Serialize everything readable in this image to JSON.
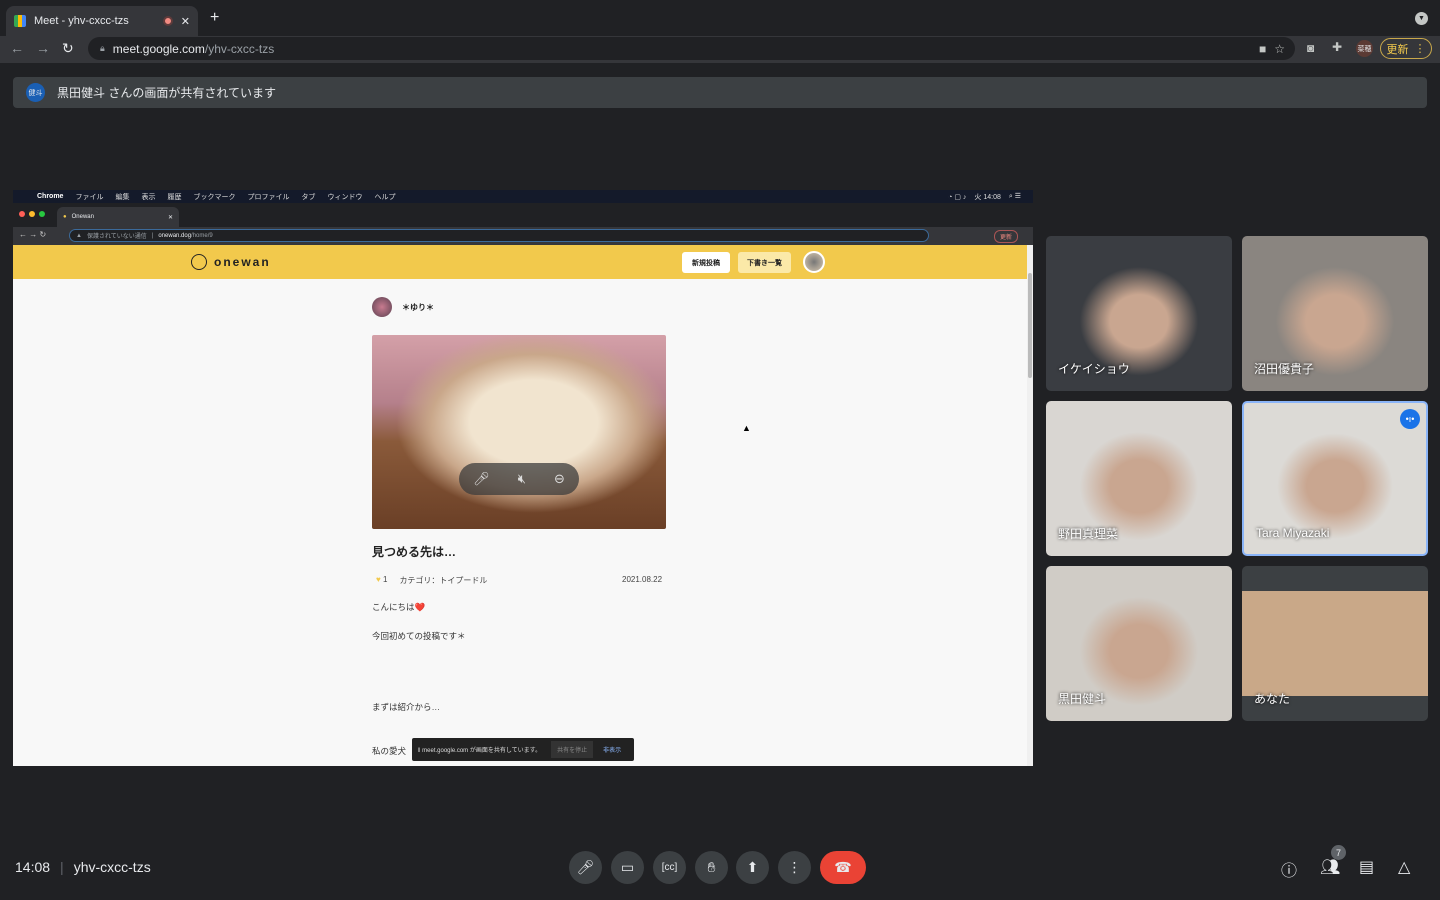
{
  "browser": {
    "tab_title": "Meet - yhv-cxcc-tzs",
    "url_host": "meet.google.com",
    "url_path": "/yhv-cxcc-tzs",
    "profile": "菜穂",
    "update_label": "更新"
  },
  "banner": {
    "avatar": "健斗",
    "text": "黒田健斗 さんの画面が共有されています"
  },
  "shared": {
    "menubar": {
      "app": "Chrome",
      "items": [
        "ファイル",
        "編集",
        "表示",
        "履歴",
        "ブックマーク",
        "プロファイル",
        "タブ",
        "ウィンドウ",
        "ヘルプ"
      ],
      "clock": "火 14:08"
    },
    "tab_title": "Onewan",
    "address": {
      "warning": "保護されていない通信",
      "host": "onewan.dog",
      "path": "/home/9",
      "update": "更新"
    },
    "site": {
      "logo": "onewan",
      "new_post": "新規投稿",
      "drafts": "下書き一覧"
    },
    "post": {
      "author": "＊ゆり＊",
      "title": "見つめる先は…",
      "likes": "1",
      "category": "カテゴリ：トイプードル",
      "date": "2021.08.22",
      "lines": [
        "こんにちは❤️",
        "今回初めての投稿です＊",
        "まずは紹介から…",
        "私の愛犬"
      ]
    },
    "toast": {
      "text": "meet.google.com が画面を共有しています。",
      "stop": "共有を停止",
      "hide": "非表示"
    }
  },
  "participants": [
    {
      "name": "イケイショウ",
      "bg": "#3a3d42"
    },
    {
      "name": "沼田優貴子",
      "bg": "#8a8580"
    },
    {
      "name": "野田真理菜",
      "bg": "#d9d6d2"
    },
    {
      "name": "Tara Miyazaki",
      "bg": "#dcdad6",
      "speaking": true
    },
    {
      "name": "黒田健斗",
      "bg": "#d0ccc6"
    },
    {
      "name": "あなた",
      "bg": "#c9a888"
    }
  ],
  "footer": {
    "time": "14:08",
    "meeting_code": "yhv-cxcc-tzs",
    "participant_count": "7"
  }
}
